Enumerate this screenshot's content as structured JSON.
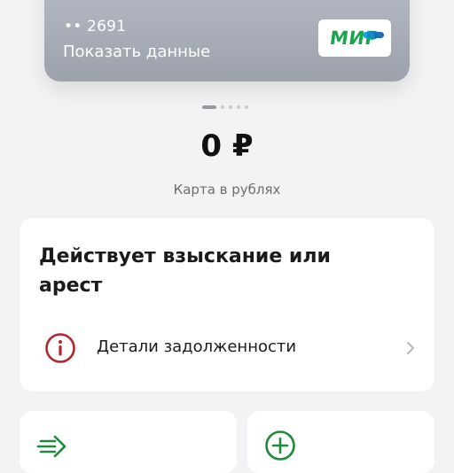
{
  "card": {
    "number_masked": "•• 2691",
    "show_details_label": "Показать данные",
    "payment_system": "МИР",
    "colors": {
      "card_bg": "#a9adb6",
      "mir_green": "#1aa64a",
      "mir_blue": "#0f4fa8"
    }
  },
  "carousel": {
    "total_pages": 5,
    "active_index": 0
  },
  "balance": {
    "amount": "0 ₽",
    "subtitle": "Карта в рублях"
  },
  "alert_card": {
    "title": "Действует взыскание или арест",
    "debt_details_label": "Детали задолженности",
    "icons": {
      "warning": "info-circle-icon",
      "chevron": "chevron-right-icon"
    },
    "colors": {
      "warning_red": "#b3262d"
    }
  },
  "actions": {
    "tiles": [
      {
        "icon": "transfer-arrow-icon"
      },
      {
        "icon": "plus-circle-icon"
      }
    ],
    "colors": {
      "icon_green": "#1f8a3c"
    }
  }
}
